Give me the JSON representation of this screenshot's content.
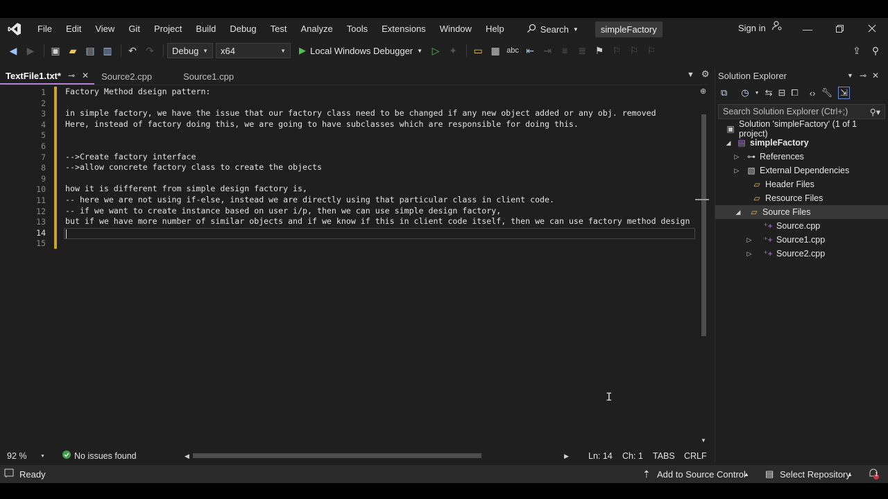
{
  "menu": {
    "items": [
      "File",
      "Edit",
      "View",
      "Git",
      "Project",
      "Build",
      "Debug",
      "Test",
      "Analyze",
      "Tools",
      "Extensions",
      "Window",
      "Help"
    ],
    "search_label": "Search",
    "solution_title": "simpleFactory",
    "sign_in": "Sign in"
  },
  "toolbar": {
    "configuration": "Debug",
    "platform": "x64",
    "debugger": "Local Windows Debugger"
  },
  "tabs": [
    {
      "label": "TextFile1.txt*",
      "active": true
    },
    {
      "label": "Source2.cpp",
      "active": false
    },
    {
      "label": "Source1.cpp",
      "active": false
    }
  ],
  "editor": {
    "lines": [
      "Factory Method dseign pattern:",
      "",
      "in simple factory, we have the issue that our factory class need to be changed if any new object added or any obj. removed",
      "Here, instead of factory doing this, we are going to have subclasses which are responsible for doing this.",
      "",
      "",
      "-->Create factory interface",
      "-->allow concrete factory class to create the objects",
      "",
      "how it is different from simple design factory is,",
      "-- here we are not using if-else, instead we are directly using that particular class in client code.",
      "-- if we want to create instance based on user i/p, then we can use simple design factory,",
      "but if we have more number of similar objects and if we know if this in client code itself, then we can use factory method design",
      "",
      ""
    ],
    "current_line": 14
  },
  "editor_status": {
    "zoom": "92 %",
    "issues": "No issues found",
    "line": "Ln: 14",
    "col": "Ch: 1",
    "indent": "TABS",
    "eol": "CRLF"
  },
  "solution_explorer": {
    "title": "Solution Explorer",
    "search_placeholder": "Search Solution Explorer (Ctrl+;)",
    "solution": "Solution 'simpleFactory' (1 of 1 project)",
    "project": "simpleFactory",
    "nodes": [
      "References",
      "External Dependencies",
      "Header Files",
      "Resource Files",
      "Source Files"
    ],
    "files": [
      "Source.cpp",
      "Source1.cpp",
      "Source2.cpp"
    ]
  },
  "status": {
    "ready": "Ready",
    "source_control": "Add to Source Control",
    "repository": "Select Repository",
    "notifications": "1"
  }
}
